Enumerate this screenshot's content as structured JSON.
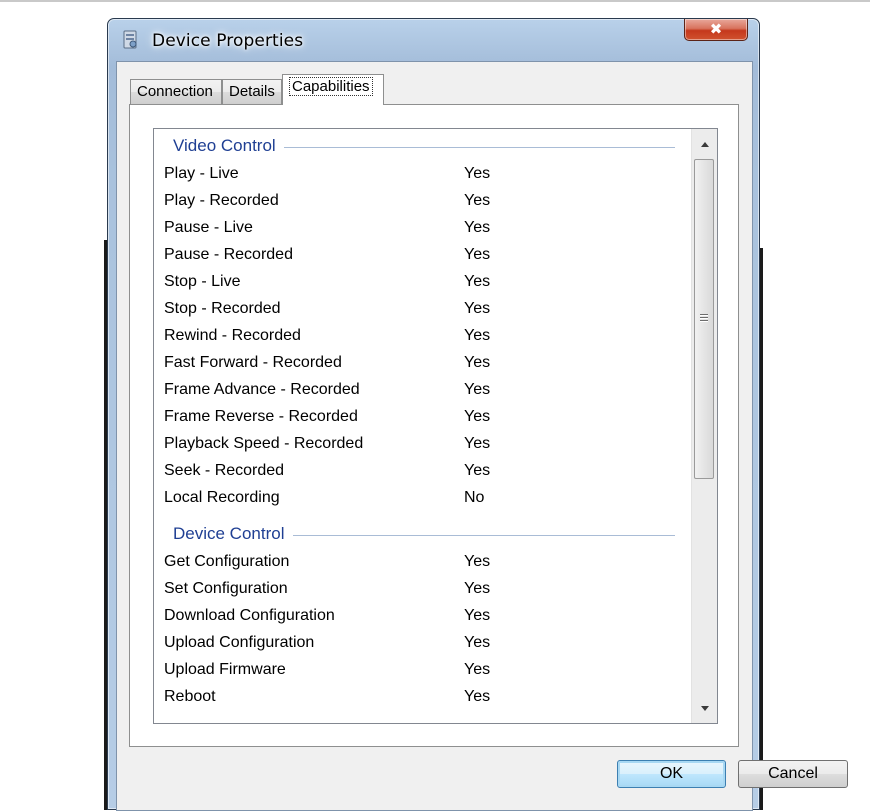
{
  "window": {
    "title": "Device Properties",
    "close_label": "✖"
  },
  "tabs": [
    {
      "label": "Connection",
      "active": false
    },
    {
      "label": "Details",
      "active": false
    },
    {
      "label": "Capabilities",
      "active": true
    }
  ],
  "capabilities": {
    "groups": [
      {
        "header": "Video Control",
        "rows": [
          {
            "label": "Play - Live",
            "value": "Yes"
          },
          {
            "label": "Play - Recorded",
            "value": "Yes"
          },
          {
            "label": "Pause - Live",
            "value": "Yes"
          },
          {
            "label": "Pause - Recorded",
            "value": "Yes"
          },
          {
            "label": "Stop - Live",
            "value": "Yes"
          },
          {
            "label": "Stop - Recorded",
            "value": "Yes"
          },
          {
            "label": "Rewind - Recorded",
            "value": "Yes"
          },
          {
            "label": "Fast Forward - Recorded",
            "value": "Yes"
          },
          {
            "label": "Frame Advance - Recorded",
            "value": "Yes"
          },
          {
            "label": "Frame Reverse - Recorded",
            "value": "Yes"
          },
          {
            "label": "Playback Speed - Recorded",
            "value": "Yes"
          },
          {
            "label": "Seek - Recorded",
            "value": "Yes"
          },
          {
            "label": "Local Recording",
            "value": "No"
          }
        ]
      },
      {
        "header": "Device Control",
        "rows": [
          {
            "label": "Get Configuration",
            "value": "Yes"
          },
          {
            "label": "Set Configuration",
            "value": "Yes"
          },
          {
            "label": "Download Configuration",
            "value": "Yes"
          },
          {
            "label": "Upload Configuration",
            "value": "Yes"
          },
          {
            "label": "Upload Firmware",
            "value": "Yes"
          },
          {
            "label": "Reboot",
            "value": "Yes"
          }
        ]
      }
    ]
  },
  "buttons": {
    "ok": "OK",
    "cancel": "Cancel"
  },
  "colors": {
    "group_header": "#1f3f93",
    "close_button": "#c5381c",
    "default_button": "#a7d9f5"
  }
}
